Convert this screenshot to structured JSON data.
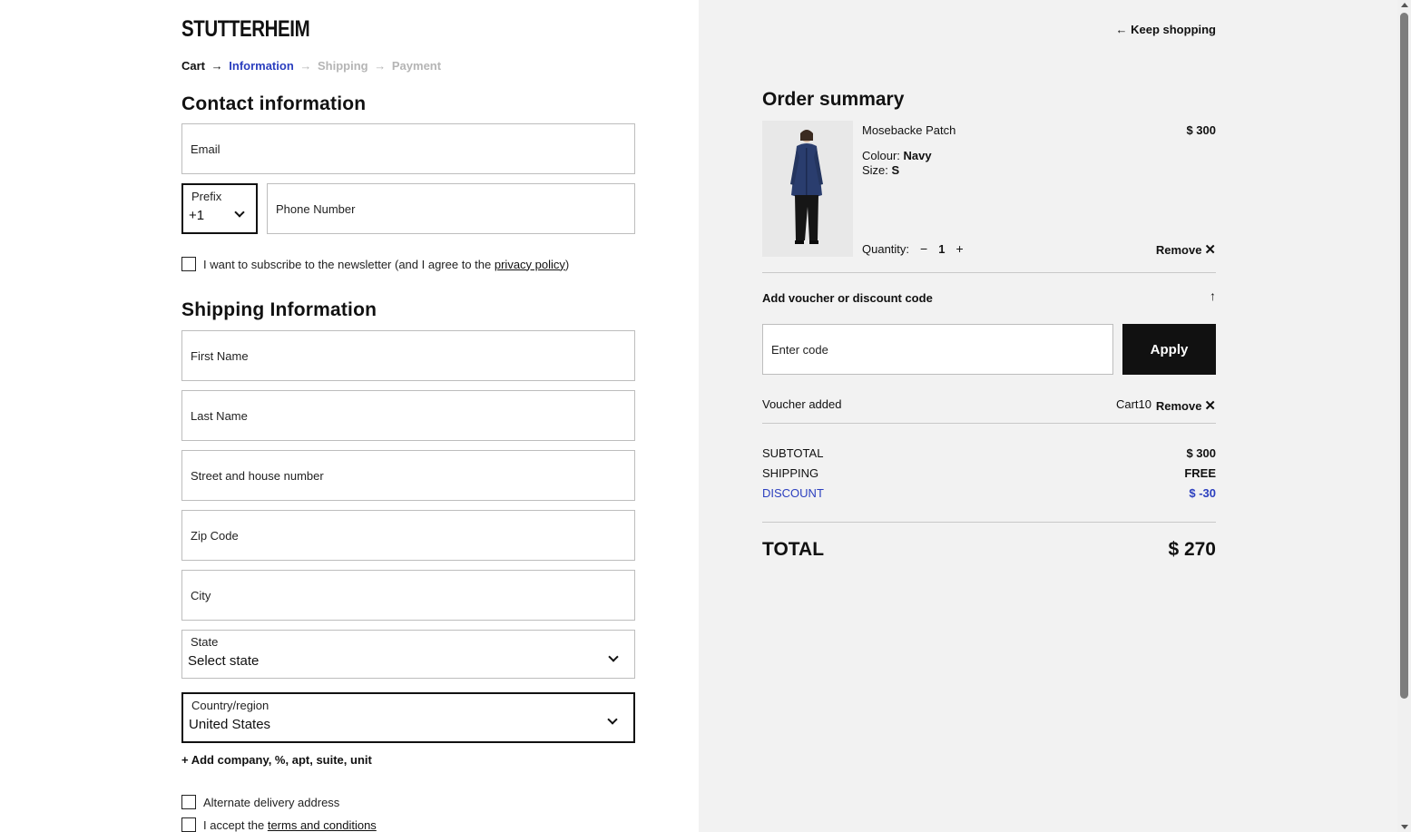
{
  "brand": {
    "logo": "STUTTERHEIM"
  },
  "breadcrumb": {
    "cart": "Cart",
    "sep": "→",
    "information": "Information",
    "shipping": "Shipping",
    "payment": "Payment"
  },
  "contact": {
    "title": "Contact information",
    "email_placeholder": "Email",
    "prefix_label": "Prefix",
    "prefix_value": "+1",
    "phone_placeholder": "Phone Number",
    "newsletter_text": "I want to subscribe to the newsletter (and I agree to the ",
    "newsletter_link": "privacy policy",
    "newsletter_close": ")"
  },
  "shipping": {
    "title": "Shipping Information",
    "first_name": "First Name",
    "last_name": "Last Name",
    "street": "Street and house number",
    "zip": "Zip Code",
    "city": "City",
    "state_label": "State",
    "state_value": "Select state",
    "country_label": "Country/region",
    "country_value": "United States",
    "add_company": "+ Add company, %, apt, suite, unit",
    "alternate_delivery": "Alternate delivery address",
    "terms_text": "I accept the ",
    "terms_link": "terms and conditions"
  },
  "summary": {
    "keep_shopping": "← Keep shopping",
    "title": "Order summary",
    "product": {
      "name": "Mosebacke Patch",
      "price": "$ 300",
      "colour_label": "Colour:",
      "colour_value": "Navy",
      "size_label": "Size:",
      "size_value": "S",
      "quantity_label": "Quantity:",
      "minus": "−",
      "quantity": "1",
      "plus": "+",
      "remove": "Remove"
    },
    "voucher": {
      "toggle": "Add voucher or discount code",
      "arrow": "↑",
      "placeholder": "Enter code",
      "apply": "Apply",
      "added_label": "Voucher added",
      "code": "Cart10",
      "remove": "Remove"
    },
    "totals": {
      "subtotal_label": "SUBTOTAL",
      "subtotal": "$ 300",
      "shipping_label": "SHIPPING",
      "shipping": "FREE",
      "discount_label": "DISCOUNT",
      "discount": "$ -30",
      "total_label": "TOTAL",
      "total": "$ 270"
    }
  },
  "colors": {
    "accent_blue": "#2b3fbf",
    "button_black": "#111111",
    "summary_bg": "#f2f2f2"
  }
}
